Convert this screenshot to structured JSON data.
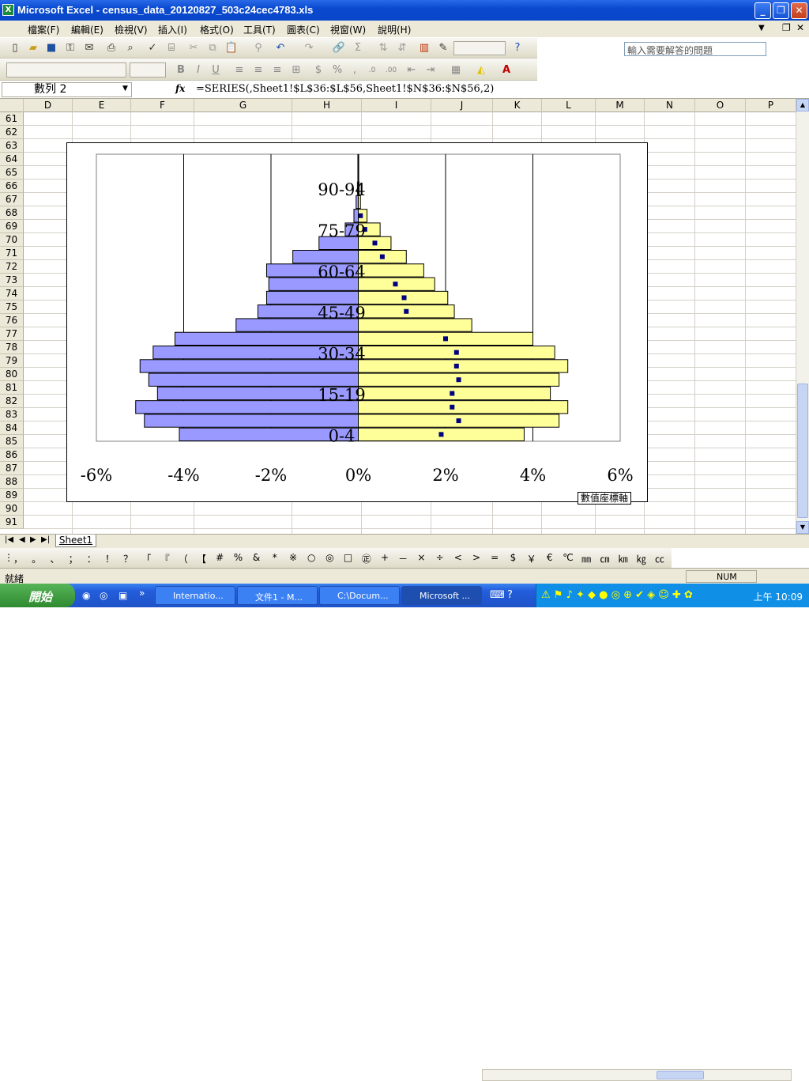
{
  "window": {
    "title": "Microsoft Excel - census_data_20120827_503c24cec4783.xls",
    "min": "_",
    "max": "❐",
    "close": "✕"
  },
  "menu": {
    "items": [
      "檔案(F)",
      "編輯(E)",
      "檢視(V)",
      "插入(I)",
      "格式(O)",
      "工具(T)",
      "圖表(C)",
      "視窗(W)",
      "說明(H)"
    ],
    "ask_placeholder": "輸入需要解答的問題"
  },
  "formula_bar": {
    "name_box": "數列 2",
    "fx": "fx",
    "formula": "=SERIES(,Sheet1!$L$36:$L$56,Sheet1!$N$36:$N$56,2)"
  },
  "columns": [
    "D",
    "E",
    "F",
    "G",
    "H",
    "I",
    "J",
    "K",
    "L",
    "M",
    "N",
    "O",
    "P"
  ],
  "rows": [
    "61",
    "62",
    "63",
    "64",
    "65",
    "66",
    "67",
    "68",
    "69",
    "70",
    "71",
    "72",
    "73",
    "74",
    "75",
    "76",
    "77",
    "78",
    "79",
    "80",
    "81",
    "82",
    "83",
    "84",
    "85",
    "86",
    "87",
    "88",
    "89",
    "90",
    "91"
  ],
  "chart_data": {
    "type": "bar",
    "orientation": "horizontal",
    "categories": [
      "0-4",
      "5-9",
      "10-14",
      "15-19",
      "20-24",
      "25-29",
      "30-34",
      "35-39",
      "40-44",
      "45-49",
      "50-54",
      "55-59",
      "60-64",
      "65-69",
      "70-74",
      "75-79",
      "80-84",
      "85-89",
      "90-94",
      "95-99",
      "100+"
    ],
    "category_labels_shown": [
      "0-4",
      "15-19",
      "30-34",
      "45-49",
      "60-64",
      "75-79",
      "90-94"
    ],
    "series": [
      {
        "values": [
          -4.1,
          -4.9,
          -5.1,
          -4.6,
          -4.8,
          -5.0,
          -4.7,
          -4.2,
          -2.8,
          -2.3,
          -2.1,
          -2.05,
          -2.1,
          -1.5,
          -0.9,
          -0.3,
          -0.1,
          -0.05,
          -0.02,
          -0.01,
          -0.01
        ],
        "color": "#9999ff"
      },
      {
        "values": [
          3.8,
          4.6,
          4.8,
          4.4,
          4.6,
          4.8,
          4.5,
          4.0,
          2.6,
          2.2,
          2.05,
          1.75,
          1.5,
          1.1,
          0.75,
          0.5,
          0.2,
          0.05,
          0.02,
          0.01,
          0.01
        ],
        "color": "#ffff99"
      },
      {
        "values": [
          1.9,
          2.3,
          2.15,
          2.15,
          2.3,
          2.25,
          2.25,
          2.0,
          null,
          1.1,
          1.05,
          0.85,
          null,
          0.55,
          0.38,
          0.15,
          0.05,
          null,
          null,
          null,
          null
        ],
        "color": "#000080",
        "marker": "square"
      }
    ],
    "xlim": [
      -6,
      6
    ],
    "x_ticks": [
      "-6%",
      "-4%",
      "-2%",
      "0%",
      "2%",
      "4%",
      "6%"
    ],
    "grid": "vertical major",
    "tooltip": "數值座標軸"
  },
  "sheet_tabs": [
    "Sheet1"
  ],
  "symbols": [
    "，",
    "。",
    "、",
    "；",
    "：",
    "！",
    "？",
    "「",
    "『",
    "（",
    "【",
    "#",
    "%",
    "&",
    "*",
    "※",
    "○",
    "◎",
    "□",
    "㊣",
    "+",
    "－",
    "×",
    "÷",
    "<",
    ">",
    "=",
    "$",
    "￥",
    "€",
    "℃",
    "㎜",
    "㎝",
    "㎞",
    "㎏",
    "㏄"
  ],
  "status": {
    "left": "就緒",
    "num": "NUM"
  },
  "taskbar": {
    "start": "開始",
    "tasks": [
      "Internatio...",
      "文件1 - M...",
      "C:\\Docum...",
      "Microsoft ..."
    ],
    "clock": "上午 10:09"
  }
}
